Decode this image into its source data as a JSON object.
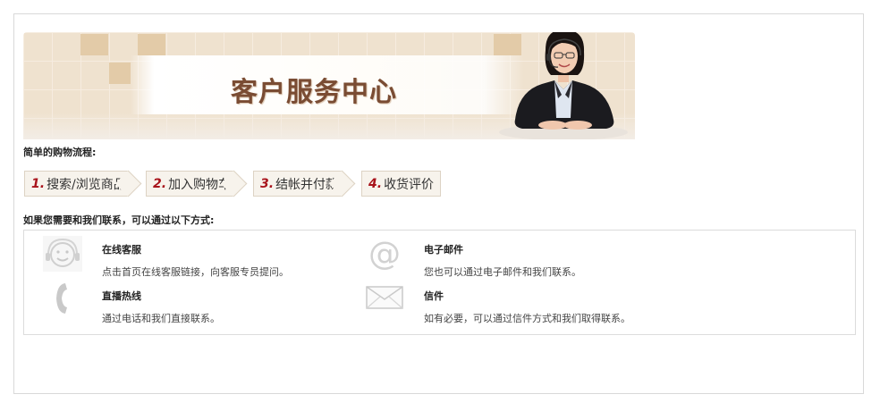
{
  "banner": {
    "title": "客户服务中心"
  },
  "shopping_flow": {
    "heading": "简单的购物流程:",
    "steps": [
      {
        "number": "1.",
        "label": "搜索/浏览商品"
      },
      {
        "number": "2.",
        "label": "加入购物车"
      },
      {
        "number": "3.",
        "label": "结帐并付款"
      },
      {
        "number": "4.",
        "label": "收货评价"
      }
    ]
  },
  "contact": {
    "heading": "如果您需要和我们联系，可以通过以下方式:",
    "methods": [
      {
        "title": "在线客服",
        "desc": "点击首页在线客服链接，向客服专员提问。",
        "icon": "headset-icon"
      },
      {
        "title": "电子邮件",
        "desc": "您也可以通过电子邮件和我们联系。",
        "icon": "at-sign-icon"
      },
      {
        "title": "直播热线",
        "desc": "通过电话和我们直接联系。",
        "icon": "phone-icon"
      },
      {
        "title": "信件",
        "desc": "如有必要，可以通过信件方式和我们取得联系。",
        "icon": "envelope-icon"
      }
    ]
  },
  "colors": {
    "step_number": "#a8131b",
    "title_brown": "#7a4c33",
    "banner_bg": "#efe2cf"
  }
}
